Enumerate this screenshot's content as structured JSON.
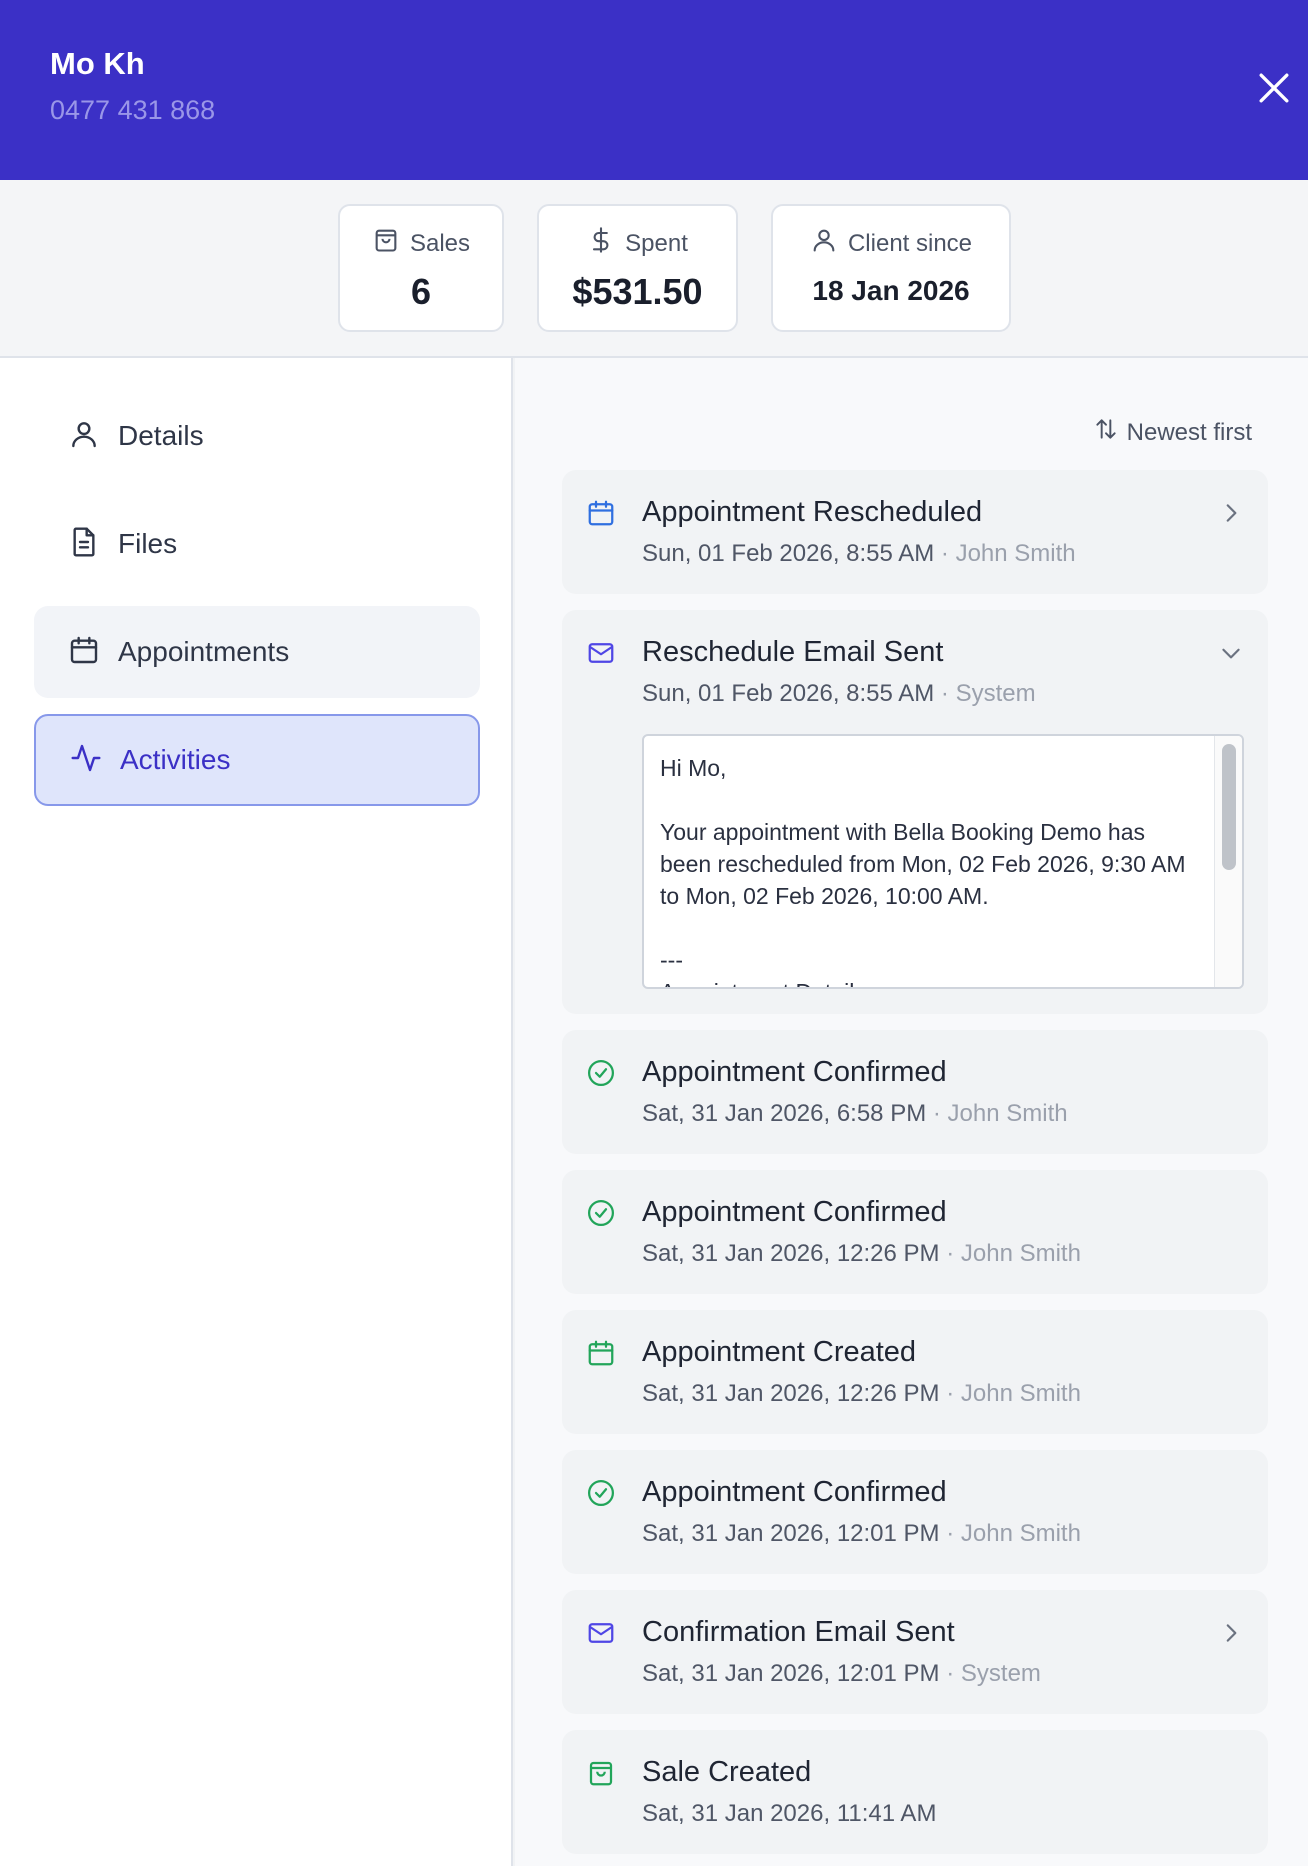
{
  "header": {
    "client_name": "Mo Kh",
    "phone": "0477 431 868",
    "close_icon": "close-icon"
  },
  "stats": [
    {
      "label": "Sales",
      "value": "6",
      "icon": "shopping-bag-icon"
    },
    {
      "label": "Spent",
      "value": "$531.50",
      "icon": "dollar-icon"
    },
    {
      "label": "Client since",
      "value": "18 Jan 2026",
      "icon": "user-icon"
    }
  ],
  "sidebar": {
    "items": [
      {
        "label": "Details",
        "icon": "user-icon"
      },
      {
        "label": "Files",
        "icon": "file-icon"
      },
      {
        "label": "Appointments",
        "icon": "calendar-icon"
      },
      {
        "label": "Activities",
        "icon": "activity-icon",
        "active": true
      }
    ]
  },
  "activities": {
    "sort_label": "Newest first",
    "items": [
      {
        "title": "Appointment Rescheduled",
        "date": "Sun, 01 Feb 2026, 8:55 AM",
        "separator": "·",
        "by": "John Smith",
        "icon": "calendar-icon",
        "icon_color": "#2f6fe0",
        "chevron": "chevron-right-icon"
      },
      {
        "title": "Reschedule Email Sent",
        "date": "Sun, 01 Feb 2026, 8:55 AM",
        "separator": "·",
        "by": "System",
        "icon": "mail-icon",
        "icon_color": "#4f46e5",
        "chevron": "chevron-down-icon",
        "email_body": "Hi Mo,\n\nYour appointment with Bella Booking Demo has been rescheduled from Mon, 02 Feb 2026, 9:30 AM to Mon, 02 Feb 2026, 10:00 AM.\n\n---\nAppointment Details"
      },
      {
        "title": "Appointment Confirmed",
        "date": "Sat, 31 Jan 2026, 6:58 PM",
        "separator": "·",
        "by": "John Smith",
        "icon": "check-circle-icon",
        "icon_color": "#22a55a"
      },
      {
        "title": "Appointment Confirmed",
        "date": "Sat, 31 Jan 2026, 12:26 PM",
        "separator": "·",
        "by": "John Smith",
        "icon": "check-circle-icon",
        "icon_color": "#22a55a"
      },
      {
        "title": "Appointment Created",
        "date": "Sat, 31 Jan 2026, 12:26 PM",
        "separator": "·",
        "by": "John Smith",
        "icon": "calendar-icon",
        "icon_color": "#22a55a"
      },
      {
        "title": "Appointment Confirmed",
        "date": "Sat, 31 Jan 2026, 12:01 PM",
        "separator": "·",
        "by": "John Smith",
        "icon": "check-circle-icon",
        "icon_color": "#22a55a"
      },
      {
        "title": "Confirmation Email Sent",
        "date": "Sat, 31 Jan 2026, 12:01 PM",
        "separator": "·",
        "by": "System",
        "icon": "mail-icon",
        "icon_color": "#4f46e5",
        "chevron": "chevron-right-icon"
      },
      {
        "title": "Sale Created",
        "date": "Sat, 31 Jan 2026, 11:41 AM",
        "icon": "shopping-bag-icon",
        "icon_color": "#22a55a"
      }
    ]
  },
  "colors": {
    "header_bg": "#3b30c6",
    "accent": "#3b30c6",
    "active_nav_bg": "#dfe5fb",
    "success": "#22a55a",
    "info_blue": "#2f6fe0"
  }
}
